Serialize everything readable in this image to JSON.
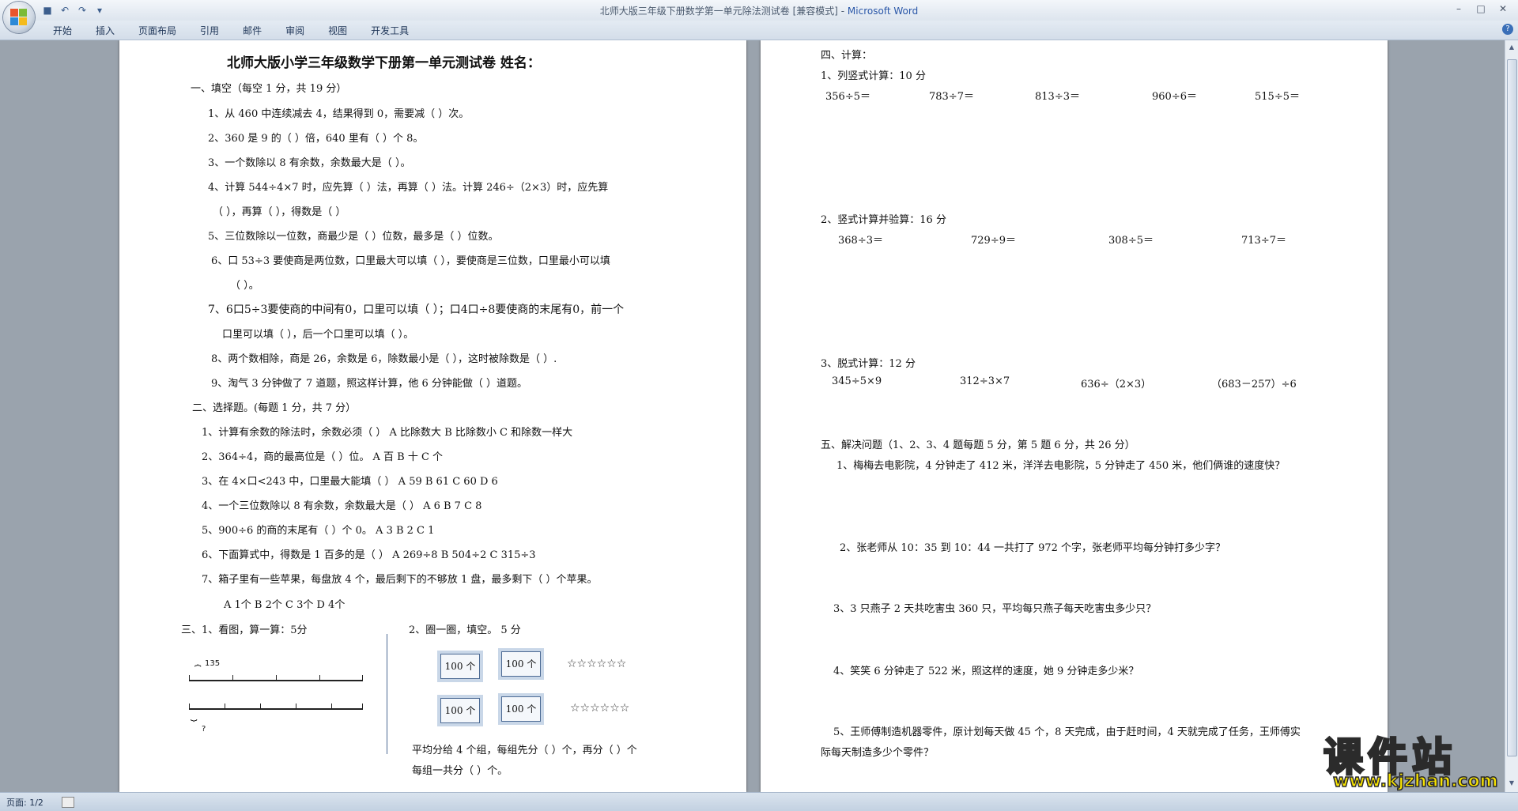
{
  "window": {
    "title": "北师大版三年级下册数学第一单元除法测试卷 [兼容模式] - ",
    "app_name": "Microsoft Word"
  },
  "ribbon": {
    "tabs": [
      "开始",
      "插入",
      "页面布局",
      "引用",
      "邮件",
      "审阅",
      "视图",
      "开发工具"
    ]
  },
  "status": {
    "page": "页面: 1/2"
  },
  "watermark": {
    "title": "课件站",
    "url": "www.kjzhan.com"
  },
  "colors": {
    "accent": "#2a57a8",
    "watermark": "#f7e300"
  },
  "left_page": {
    "title": "北师大版小学三年级数学下册第一单元测试卷   姓名：",
    "section1": {
      "heading": "一、填空（每空 1 分，共 19 分）",
      "items": [
        "1、从 460 中连续减去 4，结果得到 0，需要减（    ）次。",
        "2、360 是 9 的（    ）倍，640 里有（    ）个 8。",
        "3、一个数除以 8 有余数，余数最大是（    ）。",
        "4、计算 544÷4×7 时，应先算（    ）法，再算（    ）法。计算 246÷（2×3）时，应先算",
        "（          ），再算（          ），得数是（          ）",
        "5、三位数除以一位数，商最少是（    ）位数，最多是（    ）位数。",
        "6、口 53÷3 要使商是两位数，口里最大可以填（        ），要使商是三位数，口里最小可以填",
        "（        ）。",
        "7、6口5÷3要使商的中间有0，口里可以填（      ）；口4口÷8要使商的末尾有0，前一个",
        "口里可以填（        ），后一个口里可以填（        ）。",
        "8、两个数相除，商是 26，余数是 6，除数最小是（      ），这时被除数是（          ）.",
        "9、淘气 3 分钟做了 7 道题，照这样计算，他 6 分钟能做（        ）道题。"
      ]
    },
    "section2": {
      "heading": "二、选择题。(每题 1 分，共 7 分）",
      "items": [
        "1、计算有余数的除法时，余数必须（    ）    A  比除数大      B  比除数小    C    和除数一样大",
        "2、364÷4，商的最高位是（      ）位。                    A  百        B  十        C 个",
        "3、在 4×口<243 中，口里最大能填（      ）                  A  59        B  61        C   60          D   6",
        "4、一个三位数除以 8 有余数，余数最大是（      ）            A 6            B 7              C 8",
        "5、900÷6 的商的末尾有（      ）个 0。                      A  3            B  2                C    1",
        "6、下面算式中，得数是 1 百多的是（      ）              A 269÷8    B   504÷2     C    315÷3",
        "7、箱子里有一些苹果，每盘放 4 个，最后剩下的不够放 1 盘，最多剩下（    ）个苹果。",
        "A   1个          B   2个            C   3个          D   4个"
      ]
    },
    "section3": {
      "heading_a": "三、1、看图，算一算：5分",
      "heading_b": "2、圈一圈，填空。  5 分",
      "label_135": "135",
      "label_q": "?",
      "box_label": "100 个",
      "stars": "☆☆☆☆☆☆",
      "text1": "平均分给 4 个组，每组先分（      ）个，再分（      ）个",
      "text2": "每组一共分（          ）个。"
    }
  },
  "right_page": {
    "section4": {
      "heading": "四、计算：",
      "sub1": "1、列竖式计算：10 分",
      "row1": [
        "356÷5＝",
        "783÷7＝",
        "813÷3＝",
        "960÷6＝",
        "515÷5＝"
      ],
      "sub2": "2、竖式计算并验算：16 分",
      "row2": [
        "368÷3＝",
        "729÷9＝",
        "308÷5＝",
        "713÷7＝"
      ],
      "sub3": "3、脱式计算：12 分",
      "row3": [
        "345÷5×9",
        "312÷3×7",
        "636÷（2×3）",
        "（683－257）÷6"
      ]
    },
    "section5": {
      "heading": "五、解决问题（1、2、3、4 题每题 5 分，第 5 题 6 分，共 26 分）",
      "q1": "1、梅梅去电影院，4 分钟走了 412 米，洋洋去电影院，5 分钟走了 450 米，他们俩谁的速度快？",
      "q2": "2、张老师从 10：35 到 10：44 一共打了 972 个字，张老师平均每分钟打多少字？",
      "q3": "3、3 只燕子 2 天共吃害虫 360 只，平均每只燕子每天吃害虫多少只？",
      "q4": "4、笑笑 6 分钟走了 522 米，照这样的速度，她 9 分钟走多少米？",
      "q5a": "5、王师傅制造机器零件，原计划每天做 45 个，8 天完成，由于赶时间，4 天就完成了任务，王师傅实",
      "q5b": "际每天制造多少个零件？"
    }
  }
}
